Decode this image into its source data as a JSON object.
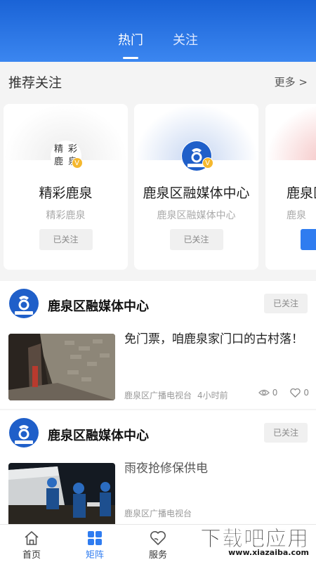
{
  "tabs": {
    "hot": "热门",
    "follow": "关注"
  },
  "recommend": {
    "title": "推荐关注",
    "more": "更多 >",
    "cards": [
      {
        "name": "精彩鹿泉",
        "sub": "精彩鹿泉",
        "button": "已关注"
      },
      {
        "name": "鹿泉区融媒体中心",
        "sub": "鹿泉区融媒体中心",
        "button": "已关注"
      },
      {
        "name": "鹿泉区",
        "sub": "鹿泉",
        "button": "+"
      }
    ],
    "verified_badge": "V",
    "logo_chars": [
      "精",
      "彩",
      "鹿",
      "泉"
    ]
  },
  "posts": [
    {
      "author": "鹿泉区融媒体中心",
      "follow": "已关注",
      "title": "免门票，咱鹿泉家门口的古村落！",
      "source": "鹿泉区广播电视台",
      "time": "4小时前",
      "views": "0",
      "likes": "0"
    },
    {
      "author": "鹿泉区融媒体中心",
      "follow": "已关注",
      "title": "雨夜抢修保供电",
      "source": "鹿泉区广播电视台",
      "time": ""
    }
  ],
  "nav": {
    "home": "首页",
    "matrix": "矩阵",
    "service": "服务"
  },
  "watermark": {
    "main": "下载吧应用",
    "url": "www.xiazaiba.com"
  },
  "colors": {
    "brand_blue": "#2f7cf0",
    "header_top": "#1a63d6",
    "badge_gold": "#f5b82e"
  }
}
